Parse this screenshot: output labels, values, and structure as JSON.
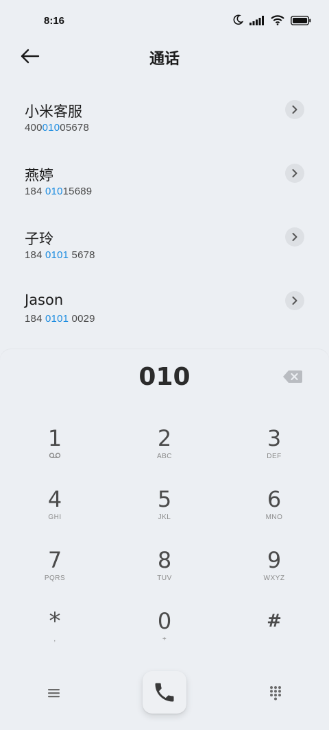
{
  "status": {
    "time": "8:16",
    "icons": [
      "moon-icon",
      "signal-icon",
      "wifi-icon",
      "battery-icon"
    ]
  },
  "header": {
    "title": "通话",
    "back_icon": "back-arrow-icon"
  },
  "contacts": [
    {
      "name": "小米客服",
      "number_pre": "400",
      "number_hl": "010",
      "number_post": "05678"
    },
    {
      "name": "燕婷",
      "number_pre": "184 ",
      "number_hl": "010",
      "number_post": "15689"
    },
    {
      "name": "子玲",
      "number_pre": "184 ",
      "number_hl": "0101",
      "number_post": " 5678"
    },
    {
      "name": "Jason",
      "number_pre": "184 ",
      "number_hl": "0101",
      "number_post": " 0029"
    }
  ],
  "dialer": {
    "input": "010",
    "keys": [
      {
        "digit": "1",
        "letters": "",
        "icon": "voicemail-icon"
      },
      {
        "digit": "2",
        "letters": "ABC"
      },
      {
        "digit": "3",
        "letters": "DEF"
      },
      {
        "digit": "4",
        "letters": "GHI"
      },
      {
        "digit": "5",
        "letters": "JKL"
      },
      {
        "digit": "6",
        "letters": "MNO"
      },
      {
        "digit": "7",
        "letters": "PQRS"
      },
      {
        "digit": "8",
        "letters": "TUV"
      },
      {
        "digit": "9",
        "letters": "WXYZ"
      },
      {
        "digit": "*",
        "letters": ","
      },
      {
        "digit": "0",
        "letters": "+"
      },
      {
        "digit": "#",
        "letters": ""
      }
    ]
  },
  "colors": {
    "background": "#eceff3",
    "highlight": "#1a8be0",
    "text_primary": "#1b1b1b",
    "text_secondary": "#4a4a4a"
  }
}
